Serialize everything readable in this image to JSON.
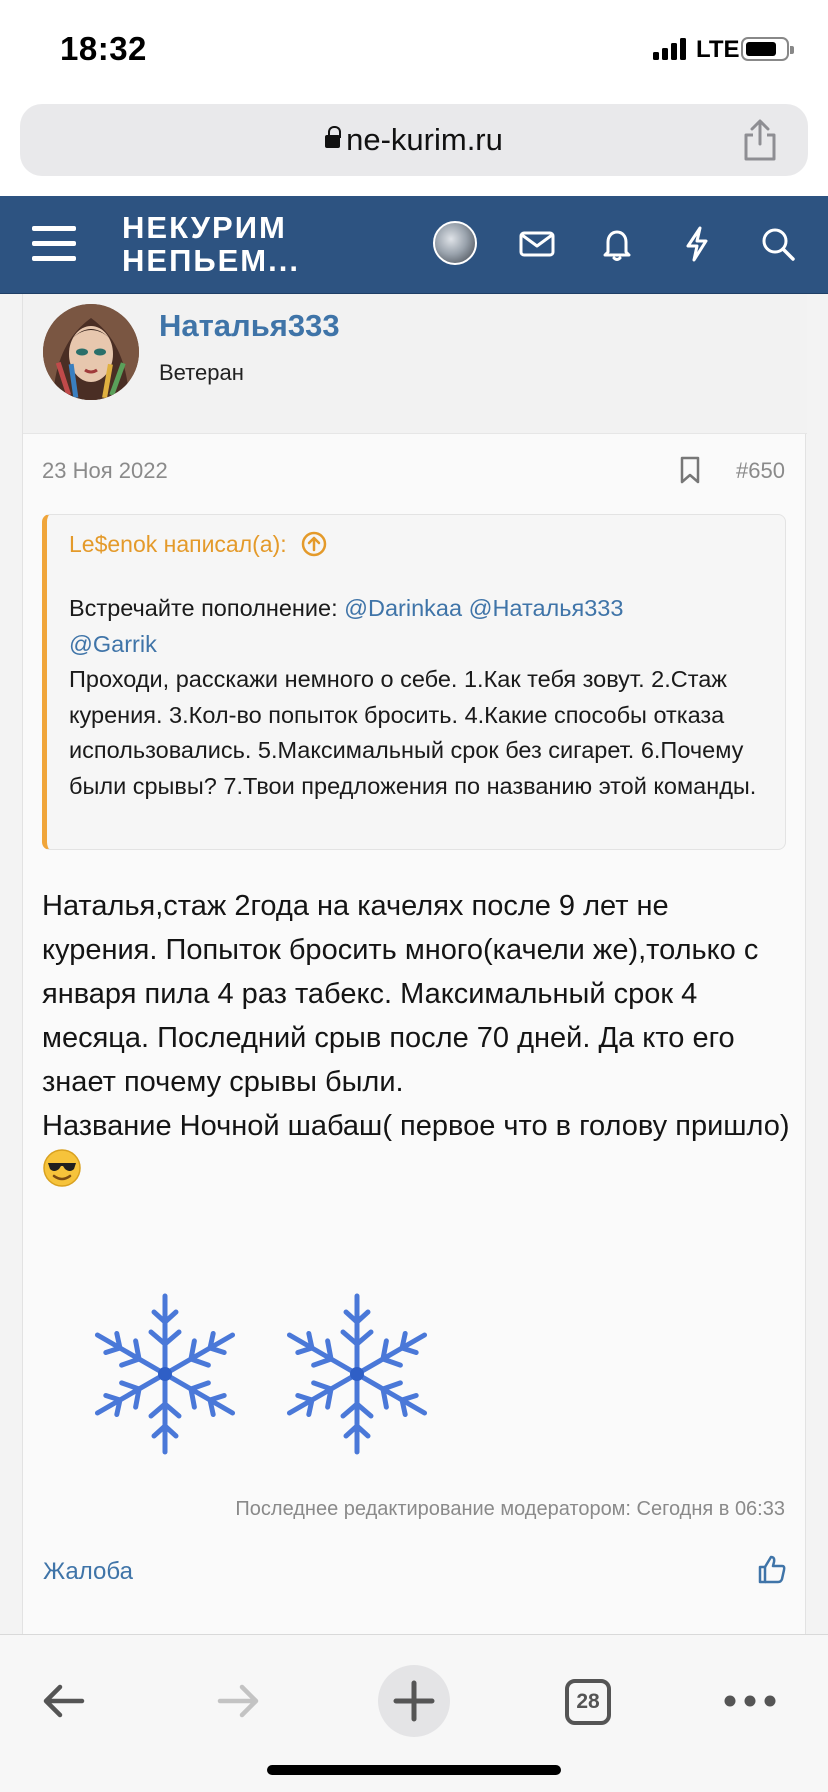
{
  "status_bar": {
    "time": "18:32",
    "network": "LTE"
  },
  "browser": {
    "url": "ne-kurim.ru",
    "tab_count": "28"
  },
  "site": {
    "logo_line1": "НЕКУРИМ",
    "logo_line2": "НЕПЬЕМ..."
  },
  "post": {
    "author": "Наталья333",
    "author_title": "Ветеран",
    "date": "23 Ноя 2022",
    "number": "#650",
    "quote": {
      "header": "Le$enok написал(а):",
      "intro": "Встречайте пополнение: ",
      "mentions": [
        "@Darinkaa",
        "@Наталья333",
        "@Garrik"
      ],
      "body": "Проходи, расскажи немного о себе. 1.Как тебя зовут. 2.Стаж курения. 3.Кол-во попыток бросить. 4.Какие способы отказа использовались. 5.Максимальный срок без сигарет. 6.Почему были срывы? 7.Твои предложения по названию этой команды."
    },
    "text_paragraph1": "Наталья,стаж 2года на качелях после 9 лет не курения. Попыток бросить много(качели же),только с января пила 4 раз табекс. Максимальный срок 4 месяца. Последний срыв после 70 дней. Да кто его знает почему срывы были.",
    "text_paragraph2": "Название Ночной шабаш( первое что в голову пришло)",
    "last_edit": "Последнее редактирование модератором: Сегодня в 06:33",
    "report_label": "Жалоба"
  },
  "colors": {
    "header_bg": "#2d5381",
    "link": "#3f74a8",
    "quote_accent": "#f0a53a"
  }
}
